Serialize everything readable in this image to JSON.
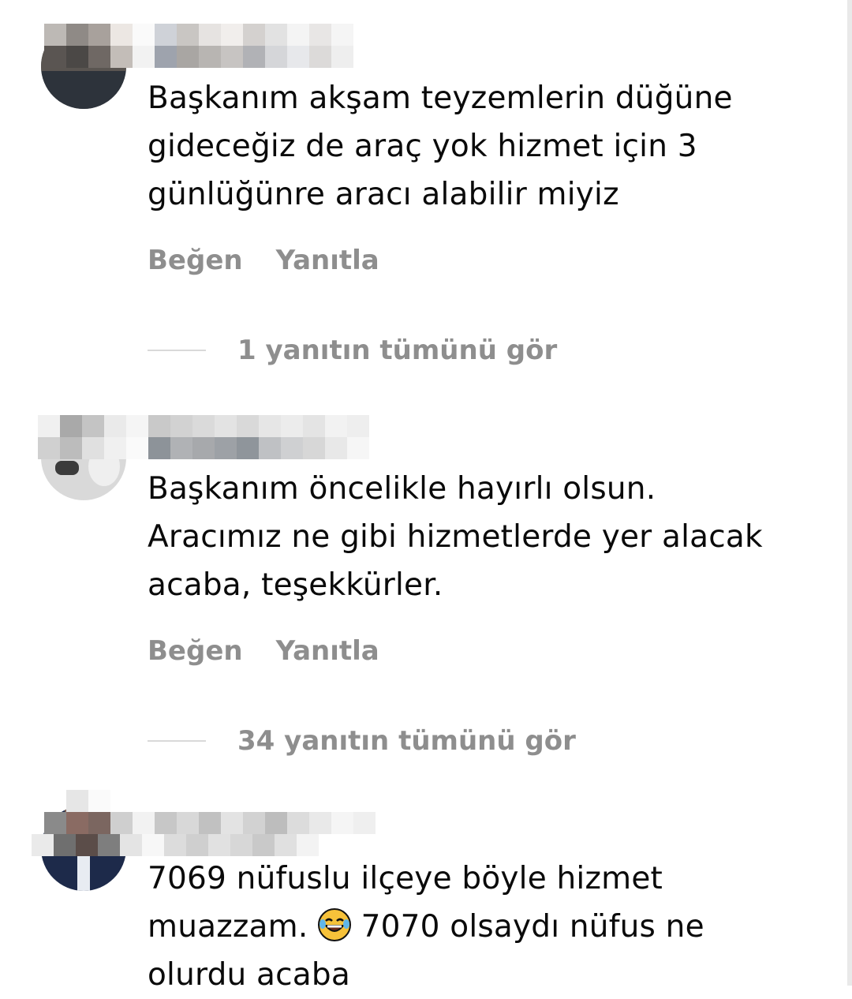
{
  "comments": [
    {
      "text": "Başkanım akşam teyzemlerin düğüne\ngideceğiz de araç yok hizmet için 3\ngünlüğünre aracı alabilir miyiz",
      "like_label": "Beğen",
      "reply_label": "Yanıtla",
      "view_replies": "1 yanıtın tümünü gör"
    },
    {
      "text": "Başkanım öncelikle hayırlı olsun.\nAracımız ne gibi hizmetlerde yer alacak\nacaba, teşekkürler.",
      "like_label": "Beğen",
      "reply_label": "Yanıtla",
      "view_replies": "34 yanıtın tümünü gör"
    },
    {
      "text_before_emoji": "7069 nüfuslu ilçeye böyle hizmet\nmuazzam. ",
      "emoji": "face-with-tears-of-joy",
      "text_after_emoji": " 7070 olsaydı nüfus ne\nolurdu acaba"
    }
  ],
  "colors": {
    "text": "#0a0a0a",
    "secondary": "#8e8e8e",
    "divider": "#d9d9d9",
    "emoji": "#f7c23a"
  }
}
